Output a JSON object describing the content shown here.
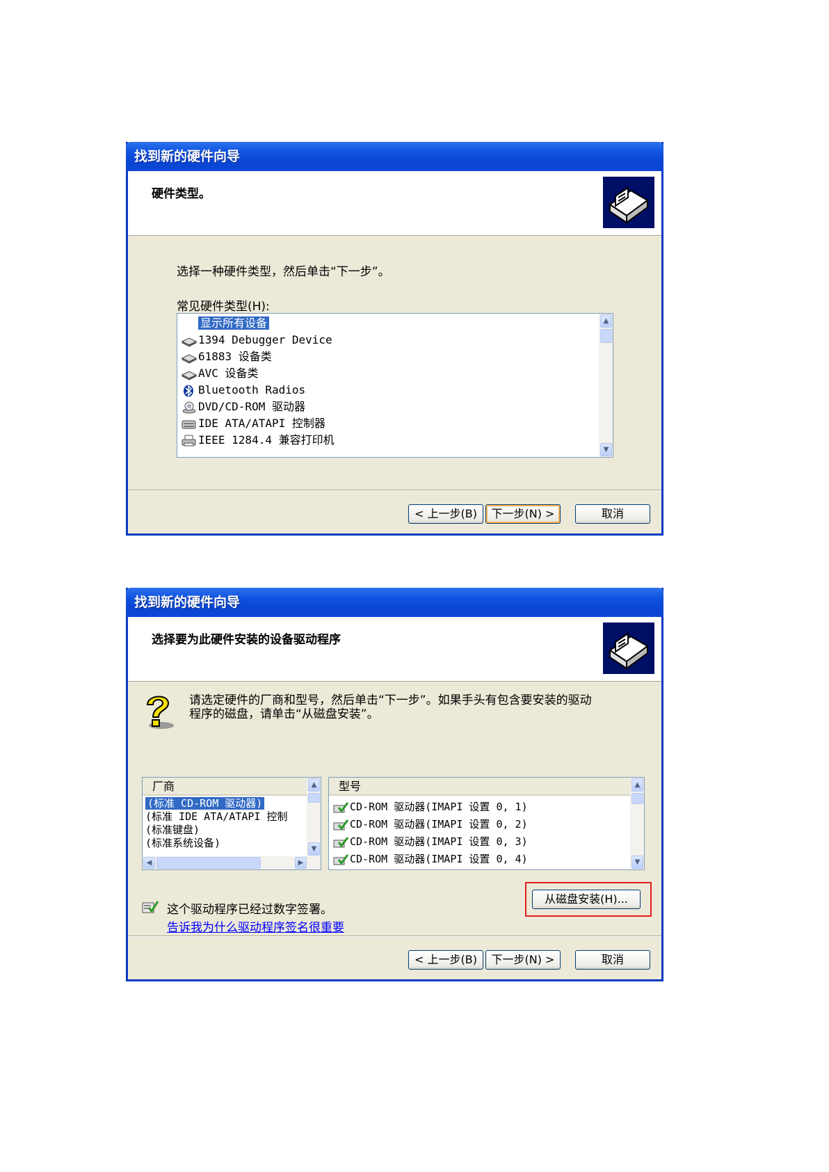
{
  "dialog1": {
    "title": "找到新的硬件向导",
    "header_title": "硬件类型。",
    "instruction": "选择一种硬件类型，然后单击“下一步”。",
    "list_label": "常见硬件类型(H):",
    "items": [
      {
        "label": "显示所有设备",
        "icon": "none",
        "selected": true
      },
      {
        "label": "1394 Debugger Device",
        "icon": "device-icon"
      },
      {
        "label": "61883 设备类",
        "icon": "device-icon"
      },
      {
        "label": "AVC 设备类",
        "icon": "device-icon"
      },
      {
        "label": "Bluetooth Radios",
        "icon": "bluetooth-icon"
      },
      {
        "label": "DVD/CD-ROM 驱动器",
        "icon": "cdrom-icon"
      },
      {
        "label": "IDE ATA/ATAPI 控制器",
        "icon": "ide-controller-icon"
      },
      {
        "label": "IEEE 1284.4 兼容打印机",
        "icon": "printer-icon"
      }
    ],
    "buttons": {
      "back": "< 上一步(B)",
      "next": "下一步(N) >",
      "cancel": "取消"
    }
  },
  "dialog2": {
    "title": "找到新的硬件向导",
    "header_title": "选择要为此硬件安装的设备驱动程序",
    "instruction_line1": "请选定硬件的厂商和型号，然后单击“下一步”。如果手头有包含要安装的驱动",
    "instruction_line2": "程序的磁盘，请单击“从磁盘安装”。",
    "manufacturer_header": "厂商",
    "manufacturers": [
      {
        "label": "(标准 CD-ROM 驱动器)",
        "selected": true
      },
      {
        "label": "(标准 IDE ATA/ATAPI 控制"
      },
      {
        "label": "(标准键盘)"
      },
      {
        "label": "(标准系统设备)"
      }
    ],
    "model_header": "型号",
    "models": [
      {
        "label": "CD-ROM 驱动器(IMAPI 设置 0, 1)"
      },
      {
        "label": "CD-ROM 驱动器(IMAPI 设置 0, 2)"
      },
      {
        "label": "CD-ROM 驱动器(IMAPI 设置 0, 3)"
      },
      {
        "label": "CD-ROM 驱动器(IMAPI 设置 0, 4)"
      }
    ],
    "signed_text": "这个驱动程序已经过数字签署。",
    "signing_link": "告诉我为什么驱动程序签名很重要",
    "have_disk": "从磁盘安装(H)...",
    "buttons": {
      "back": "< 上一步(B)",
      "next": "下一步(N) >",
      "cancel": "取消"
    }
  },
  "colors": {
    "title_blue": "#0a45d1",
    "face": "#ece9d8",
    "selection": "#316ac5",
    "highlight_box": "#e02020"
  }
}
